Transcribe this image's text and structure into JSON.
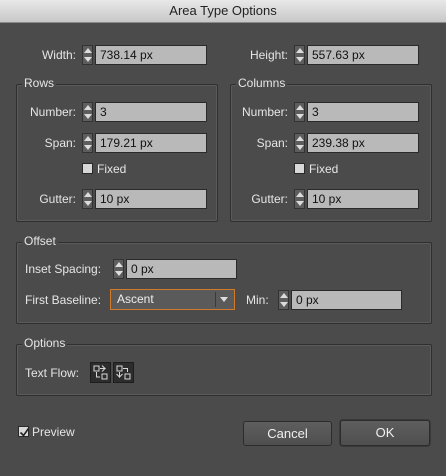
{
  "window": {
    "title": "Area Type Options"
  },
  "size": {
    "width_label": "Width:",
    "width_value": "738.14 px",
    "height_label": "Height:",
    "height_value": "557.63 px"
  },
  "rows": {
    "title": "Rows",
    "number_label": "Number:",
    "number_value": "3",
    "span_label": "Span:",
    "span_value": "179.21 px",
    "fixed_label": "Fixed",
    "gutter_label": "Gutter:",
    "gutter_value": "10 px"
  },
  "columns": {
    "title": "Columns",
    "number_label": "Number:",
    "number_value": "3",
    "span_label": "Span:",
    "span_value": "239.38 px",
    "fixed_label": "Fixed",
    "gutter_label": "Gutter:",
    "gutter_value": "10 px"
  },
  "offset": {
    "title": "Offset",
    "inset_label": "Inset Spacing:",
    "inset_value": "0 px",
    "first_baseline_label": "First Baseline:",
    "first_baseline_value": "Ascent",
    "min_label": "Min:",
    "min_value": "0 px"
  },
  "options": {
    "title": "Options",
    "text_flow_label": "Text Flow:",
    "icons": [
      "text-flow-rows-icon",
      "text-flow-columns-icon"
    ]
  },
  "footer": {
    "preview_label": "Preview",
    "preview_checked": true,
    "cancel_label": "Cancel",
    "ok_label": "OK"
  },
  "colors": {
    "background": "#4b4b4b",
    "field": "#b9b9b9",
    "focus": "#d07a2a"
  }
}
